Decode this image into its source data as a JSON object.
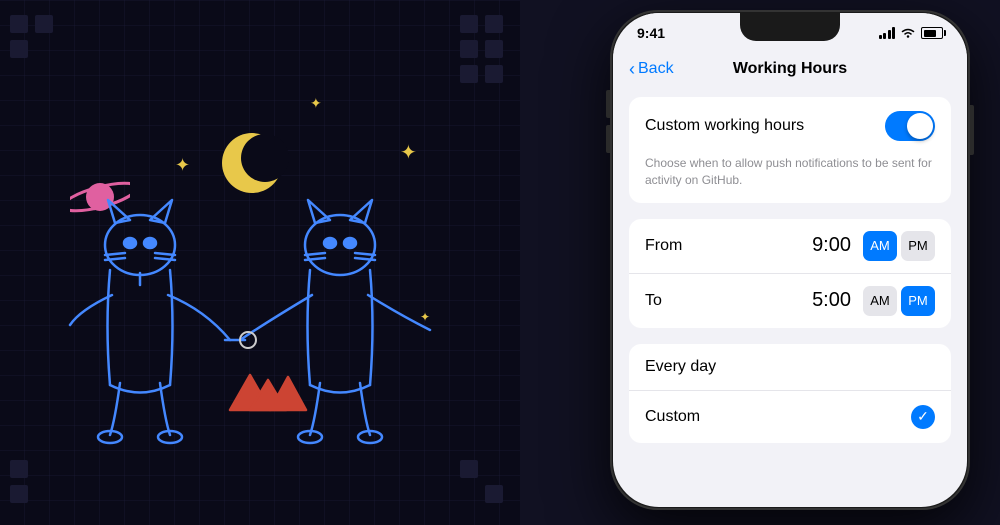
{
  "background": {
    "color": "#0a0a18"
  },
  "status_bar": {
    "time": "9:41",
    "signal": "full",
    "wifi": true,
    "battery": "75"
  },
  "nav": {
    "back_label": "Back",
    "title": "Working Hours"
  },
  "toggle_section": {
    "label": "Custom working hours",
    "enabled": true,
    "description": "Choose when to allow push notifications to be sent for activity on GitHub."
  },
  "from_row": {
    "label": "From",
    "time": "9:00",
    "am_active": true,
    "am_label": "AM",
    "pm_label": "PM"
  },
  "to_row": {
    "label": "To",
    "time": "5:00",
    "am_active": false,
    "am_label": "AM",
    "pm_label": "PM"
  },
  "day_options": [
    {
      "label": "Every day",
      "selected": false
    },
    {
      "label": "Custom",
      "selected": true
    }
  ]
}
